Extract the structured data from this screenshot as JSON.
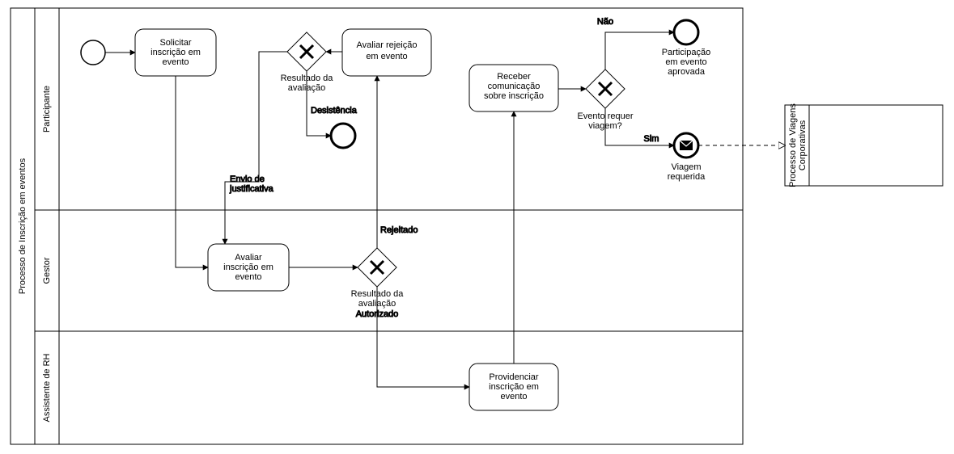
{
  "pool": {
    "title": "Processo de Inscrição em eventos",
    "lanes": [
      {
        "id": "participante",
        "title": "Participante"
      },
      {
        "id": "gestor",
        "title": "Gestor"
      },
      {
        "id": "assistente",
        "title": "Assistente de RH"
      }
    ]
  },
  "tasks": {
    "solicitar": {
      "label": "Solicitar inscrição em evento"
    },
    "avaliar_rej": {
      "label": "Avaliar rejeição em evento"
    },
    "receber": {
      "label": "Receber comunicação sobre inscrição"
    },
    "avaliar_insc": {
      "label": "Avaliar inscrição em evento"
    },
    "providenciar": {
      "label": "Providenciar inscrição em evento"
    }
  },
  "gateways": {
    "g1": {
      "label": "Resultado da avaliação"
    },
    "g2": {
      "label": "Resultado da avaliação"
    },
    "g3": {
      "label": "Evento requer viagem?"
    }
  },
  "edges": {
    "desistencia": "Desistência",
    "envio_just": "Envio de justificativa",
    "rejeitado": "Rejeitado",
    "autorizado": "Autorizado",
    "nao": "Não",
    "sim": "Sim"
  },
  "ends": {
    "aprovada": "Participação em evento aprovada",
    "viagem": "Viagem requerida"
  },
  "external_pool": {
    "title": "Processo de Viagens Corporativas"
  }
}
